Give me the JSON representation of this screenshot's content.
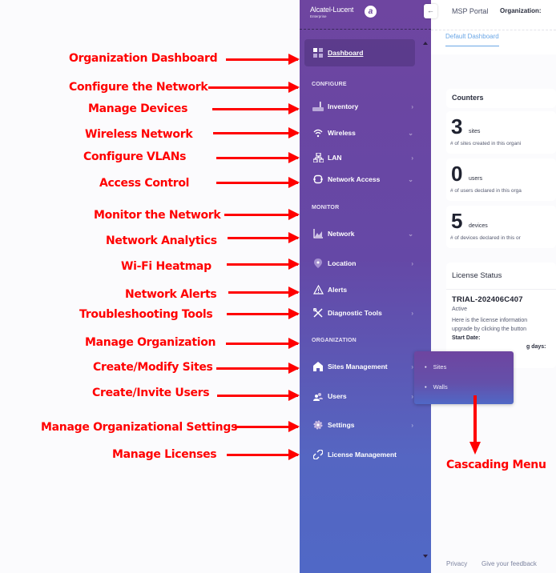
{
  "sidebar": {
    "logo": {
      "brand": "Alcatel-Lucent",
      "sub": "Enterprise"
    },
    "dashboard": {
      "label": "Dashboard",
      "icon": "dashboard-grid-icon"
    },
    "sections": {
      "configure": "CONFIGURE",
      "monitor": "MONITOR",
      "organization": "ORGANIZATION"
    },
    "items": [
      {
        "label": "Inventory",
        "icon": "router-icon",
        "chevron": "›"
      },
      {
        "label": "Wireless",
        "icon": "wifi-icon",
        "chevron": "⌄"
      },
      {
        "label": "LAN",
        "icon": "network-topology-icon",
        "chevron": "›"
      },
      {
        "label": "Network Access",
        "icon": "access-icon",
        "chevron": "⌄"
      },
      {
        "label": "Network",
        "icon": "chart-icon",
        "chevron": "⌄"
      },
      {
        "label": "Location",
        "icon": "location-pin-icon",
        "chevron": "›"
      },
      {
        "label": "Alerts",
        "icon": "alert-triangle-icon",
        "chevron": ""
      },
      {
        "label": "Diagnostic Tools",
        "icon": "tools-icon",
        "chevron": "›"
      },
      {
        "label": "Sites Management",
        "icon": "home-icon",
        "chevron": "›"
      },
      {
        "label": "Users",
        "icon": "users-icon",
        "chevron": "›"
      },
      {
        "label": "Settings",
        "icon": "gear-icon",
        "chevron": "›"
      },
      {
        "label": "License Management",
        "icon": "link-icon",
        "chevron": ""
      }
    ]
  },
  "cascade_menu": {
    "items": [
      "Sites",
      "Walls"
    ]
  },
  "header": {
    "collapse_icon": "←",
    "portal": "MSP Portal",
    "org_label": "Organization:"
  },
  "tabs": {
    "active": "Default Dashboard"
  },
  "counters": {
    "title": "Counters",
    "items": [
      {
        "value": "3",
        "unit": "sites",
        "desc": "# of sites created in this organi"
      },
      {
        "value": "0",
        "unit": "users",
        "desc": "# of users declared in this orga"
      },
      {
        "value": "5",
        "unit": "devices",
        "desc": "# of devices declared in this or"
      }
    ]
  },
  "license": {
    "title": "License Status",
    "id": "TRIAL-202406C407",
    "status": "Active",
    "text1": "Here is the license information",
    "text2": "upgrade by clicking the button",
    "start_date": "Start Date:",
    "remaining": "g days:"
  },
  "footer": {
    "privacy": "Privacy",
    "feedback": "Give your feedback"
  },
  "annotations": [
    "Organization Dashboard",
    "Configure the Network",
    "Manage Devices",
    "Wireless Network",
    "Configure VLANs",
    "Access Control",
    "Monitor the Network",
    "Network Analytics",
    "Wi-Fi Heatmap",
    "Network Alerts",
    "Troubleshooting Tools",
    "Manage Organization",
    "Create/Modify Sites",
    "Create/Invite Users",
    "Manage Organizational Settings",
    "Manage Licenses",
    "Cascading Menu"
  ],
  "colors": {
    "annotation": "#ff0000",
    "sidebar_top": "#6e45a0",
    "sidebar_bottom": "#5068c6",
    "tab_accent": "#6aa6e6"
  }
}
